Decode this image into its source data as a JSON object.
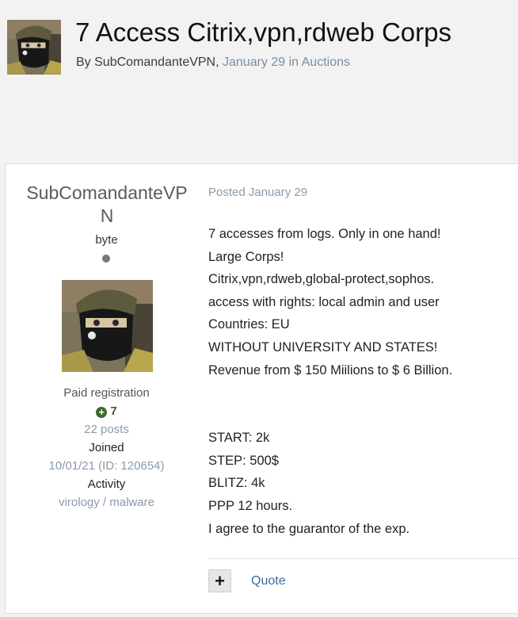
{
  "topic": {
    "title": "7 Access Citrix,vpn,rdweb Corps",
    "by_label": "By",
    "author": "SubComandanteVPN",
    "date_forum": "January 29 in Auctions"
  },
  "author_panel": {
    "name": "SubComandanteVPN",
    "rank": "byte",
    "group": "Paid registration",
    "reputation": "7",
    "posts": "22 posts",
    "joined_label": "Joined",
    "joined_value": "10/01/21 (ID: 120654)",
    "activity_label": "Activity",
    "activity_value": "virology / malware"
  },
  "post": {
    "posted": "Posted January 29",
    "lines_top": [
      "7 accesses from logs. Only in one hand!",
      "Large Corps!",
      "Citrix,vpn,rdweb,global-protect,sophos.",
      "access with rights: local admin and user",
      "Countries: EU",
      "WITHOUT UNIVERSITY AND STATES!",
      "Revenue from $ 150 Miilions to $ 6 Billion."
    ],
    "lines_bottom": [
      "START: 2k",
      "STEP: 500$",
      "BLITZ: 4k",
      "PPP 12 hours.",
      "I agree to the guarantor of the exp."
    ],
    "plus_label": "+",
    "quote_label": "Quote"
  },
  "icons": {
    "avatar": "masked-soldier-avatar",
    "reputation": "plus-circle-icon",
    "online": "status-dot-icon"
  }
}
